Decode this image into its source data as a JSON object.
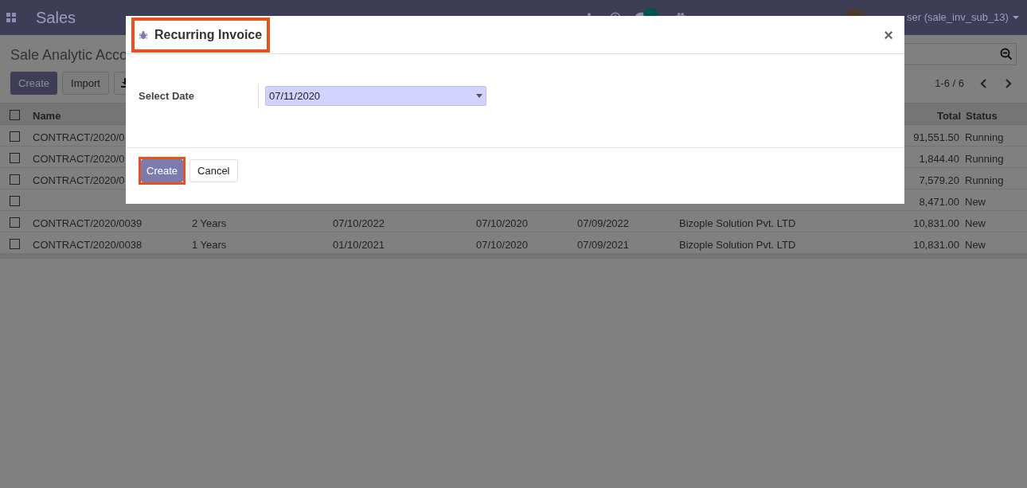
{
  "navbar": {
    "app_name": "Sales",
    "user": "ser (sale_inv_sub_13)"
  },
  "control_panel": {
    "breadcrumb": "Sale Analytic Acco",
    "buttons": [
      "Create",
      "Import"
    ],
    "pager": "1-6 / 6"
  },
  "table": {
    "columns": [
      "Name",
      "Total",
      "Status"
    ],
    "header_checked": false,
    "rows": [
      {
        "checked": false,
        "name": "CONTRACT/2020/0",
        "cells": [],
        "total": "91,551.50",
        "status": "Running"
      },
      {
        "checked": false,
        "name": "CONTRACT/2020/0",
        "cells": [],
        "total": "1,844.40",
        "status": "Running"
      },
      {
        "checked": false,
        "name": "CONTRACT/2020/0",
        "cells": [],
        "total": "7,579.20",
        "status": "Running"
      },
      {
        "checked": false,
        "cells": [],
        "total": "8,471.00",
        "status": "New"
      },
      {
        "checked": false,
        "name": "CONTRACT/2020/0039",
        "cells": [
          "2 Years",
          "07/10/2022",
          "07/10/2020",
          "07/09/2022",
          "Bizople Solution Pvt. LTD"
        ],
        "total": "10,831.00",
        "status": "New"
      },
      {
        "checked": false,
        "name": "CONTRACT/2020/0038",
        "cells": [
          "1 Years",
          "01/10/2021",
          "07/10/2020",
          "07/09/2021",
          "Bizople Solution Pvt. LTD"
        ],
        "total": "10,831.00",
        "status": "New"
      }
    ]
  },
  "dialog": {
    "title": "Recurring Invoice",
    "close": "×",
    "field_label": "Select Date",
    "field_value": "07/11/2020",
    "buttons": [
      {
        "label": "Create",
        "primary": true,
        "highlighted": true
      },
      {
        "label": "Cancel",
        "primary": false,
        "highlighted": false
      }
    ],
    "title_highlighted": true
  }
}
